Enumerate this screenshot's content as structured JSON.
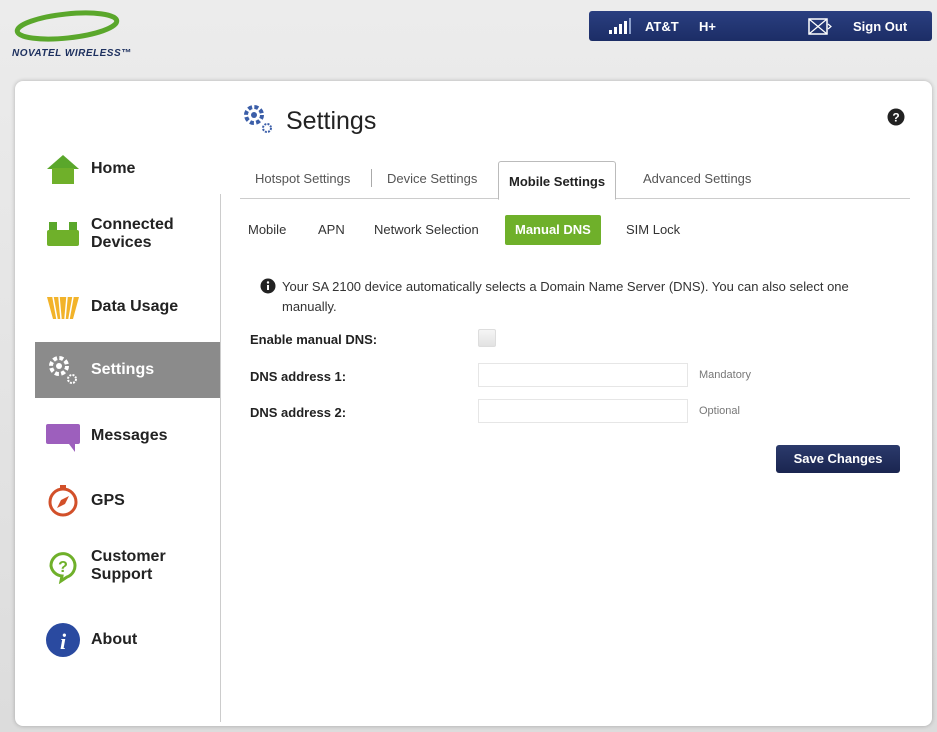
{
  "brand": {
    "logo_text": "NOVATEL WIRELESS™"
  },
  "topbar": {
    "carrier": "AT&T",
    "network_type": "H+",
    "sign_out_label": "Sign Out"
  },
  "sidebar": {
    "items": [
      {
        "label": "Home",
        "icon": "home-icon"
      },
      {
        "label": "Connected Devices",
        "icon": "connected-devices-icon"
      },
      {
        "label": "Data Usage",
        "icon": "data-usage-icon"
      },
      {
        "label": "Settings",
        "icon": "settings-icon",
        "active": true
      },
      {
        "label": "Messages",
        "icon": "messages-icon"
      },
      {
        "label": "GPS",
        "icon": "gps-icon"
      },
      {
        "label": "Customer Support",
        "icon": "customer-support-icon"
      },
      {
        "label": "About",
        "icon": "about-icon"
      }
    ]
  },
  "page": {
    "title": "Settings"
  },
  "tabs": [
    {
      "label": "Hotspot Settings"
    },
    {
      "label": "Device Settings"
    },
    {
      "label": "Mobile Settings",
      "active": true
    },
    {
      "label": "Advanced Settings"
    }
  ],
  "subtabs": [
    {
      "label": "Mobile"
    },
    {
      "label": "APN"
    },
    {
      "label": "Network Selection"
    },
    {
      "label": "Manual DNS",
      "active": true
    },
    {
      "label": "SIM Lock"
    }
  ],
  "info": {
    "text": "Your SA 2100 device automatically selects a Domain Name Server (DNS). You can also select one manually."
  },
  "form": {
    "enable_label": "Enable manual DNS:",
    "enable_checked": false,
    "dns1_label": "DNS address 1:",
    "dns1_value": "",
    "dns1_hint": "Mandatory",
    "dns2_label": "DNS address 2:",
    "dns2_value": "",
    "dns2_hint": "Optional",
    "save_label": "Save Changes"
  },
  "colors": {
    "topbar": "#1c2d66",
    "active_nav": "#8b8b8b",
    "active_subtab": "#6fb02a",
    "save_button": "#1a2550",
    "logo_green": "#5aa72b"
  }
}
